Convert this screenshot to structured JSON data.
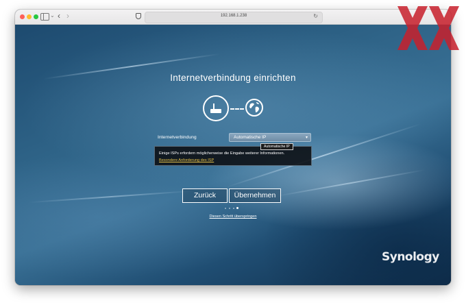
{
  "browser": {
    "url": "192.168.1.238"
  },
  "page": {
    "title": "Internetverbindung einrichten",
    "connection_label": "Internetverbindung",
    "connection_value": "Automatische IP",
    "tooltip": "Automatische IP",
    "info_text": "Einige ISPs erfordern möglicherweise die Eingabe weiterer Informationen.",
    "info_link": "Besondere Anforderung des ISP",
    "back_button": "Zurück",
    "apply_button": "Übernehmen",
    "steps_total": 4,
    "steps_current": 4,
    "skip_link": "Diesen Schritt überspringen",
    "brand": "Synology"
  },
  "colors": {
    "accent_link": "#e7c34a",
    "watermark": "#c8202c"
  }
}
